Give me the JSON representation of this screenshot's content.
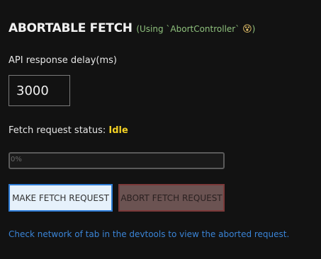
{
  "header": {
    "title": "ABORTABLE FETCH",
    "subtitle": "(Using `AbortController`",
    "emoji": "😵",
    "subtitle_close": ")"
  },
  "delay": {
    "label": "API response delay(ms)",
    "value": "3000"
  },
  "status": {
    "label": "Fetch request status:",
    "value": "Idle"
  },
  "progress": {
    "percent": 0,
    "text": "0%"
  },
  "buttons": {
    "make_label": "MAKE FETCH REQUEST",
    "abort_label": "ABORT FETCH REQUEST"
  },
  "note": "Check network of tab in the devtools to view the aborted request.",
  "colors": {
    "background": "#121212",
    "accent_green": "#8ec07c",
    "status_yellow": "#f2d024",
    "link_blue": "#3a84d6",
    "button_primary_border": "#2f7dd6",
    "button_abort_bg": "#6b5352"
  }
}
